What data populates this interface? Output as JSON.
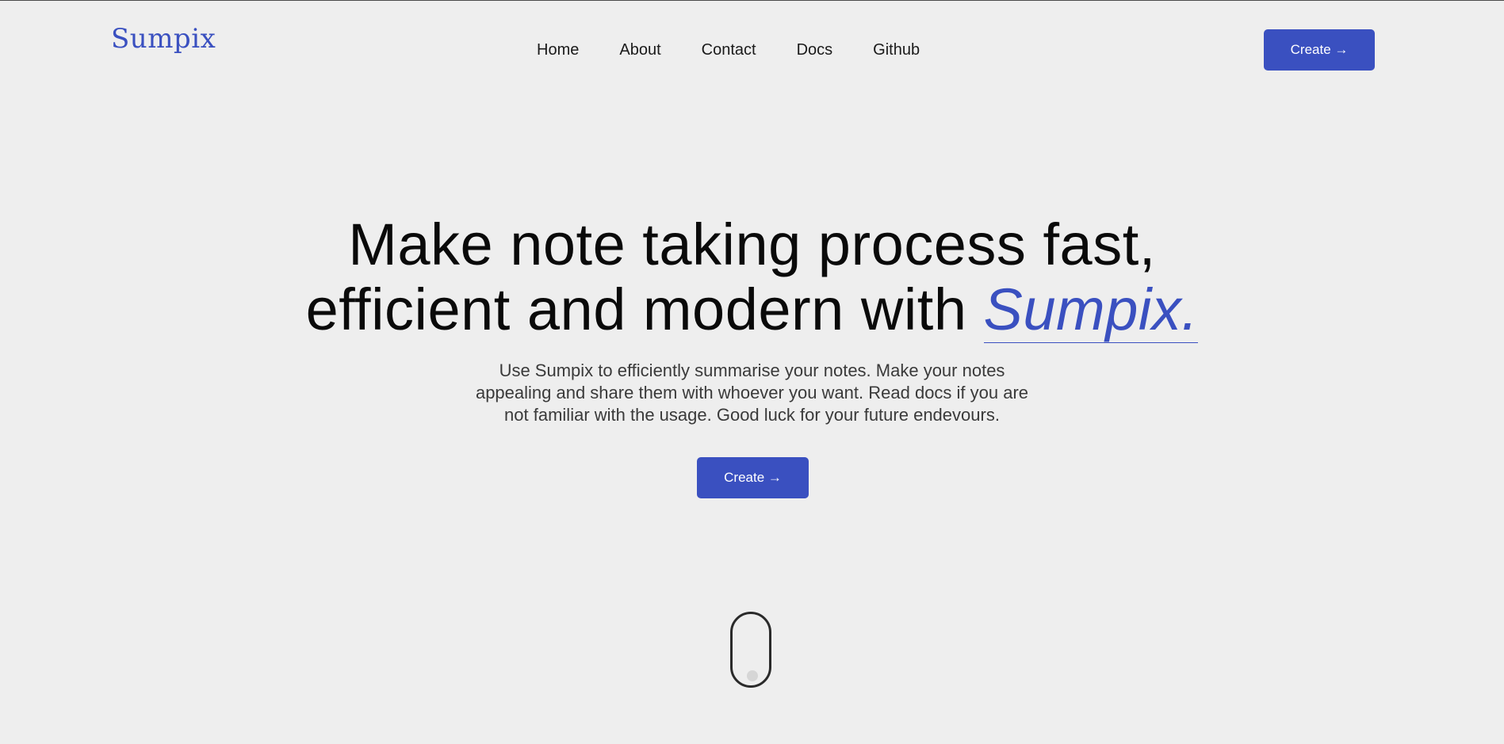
{
  "brand": {
    "logo_text": "Sumpix",
    "accent_color": "#3a50c0"
  },
  "nav": {
    "items": [
      {
        "label": "Home"
      },
      {
        "label": "About"
      },
      {
        "label": "Contact"
      },
      {
        "label": "Docs"
      },
      {
        "label": "Github"
      }
    ]
  },
  "header": {
    "cta_label": "Create →"
  },
  "hero": {
    "title_line1": "Make note taking process fast,",
    "title_line2_prefix": "efficient and modern with ",
    "title_brand": "Sumpix.",
    "subtitle_line1": "Use Sumpix to efficiently summarise your notes. Make your notes",
    "subtitle_line2": "appealing and share them with whoever you want. Read docs if you are",
    "subtitle_line3": "not familiar with the usage. Good luck for your future endevours.",
    "cta_label": "Create →"
  },
  "scroll_indicator": {
    "icon": "mouse-scroll-icon"
  }
}
